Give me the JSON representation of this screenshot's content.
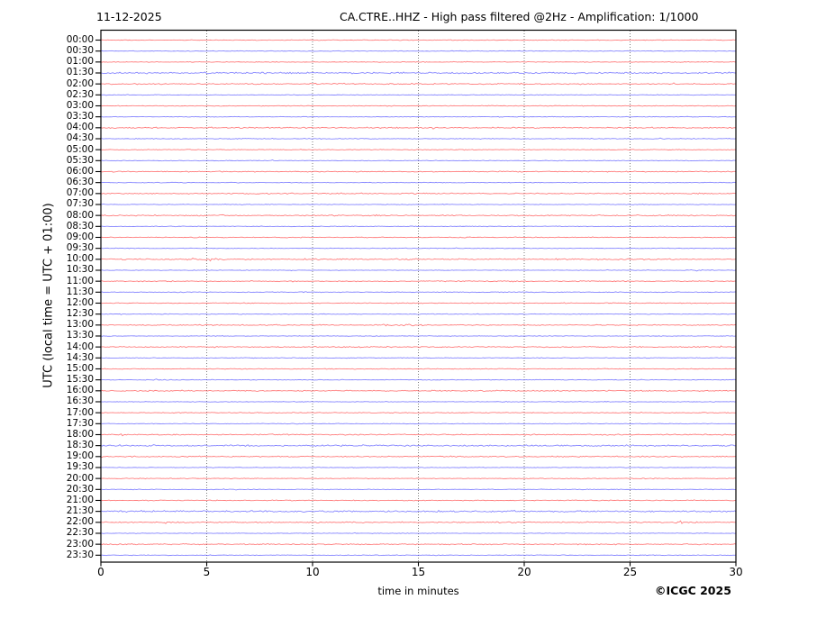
{
  "header": {
    "date_label": "11-12-2025",
    "title": "CA.CTRE..HHZ - High pass filtered @2Hz - Amplification: 1/1000"
  },
  "footer": {
    "copyright": "©ICGC 2025"
  },
  "chart_data": {
    "type": "line",
    "subtype": "helicorder-seismogram",
    "title": "CA.CTRE..HHZ - High pass filtered @2Hz - Amplification: 1/1000",
    "date": "11-12-2025",
    "xlabel": "time in minutes",
    "ylabel": "UTC (local time = UTC + 01:00)",
    "x_range": [
      0,
      30
    ],
    "x_ticks": [
      "0",
      "5",
      "10",
      "15",
      "20",
      "25",
      "30"
    ],
    "x_gridlines_minutes": [
      5,
      10,
      15,
      20,
      25
    ],
    "grid_style": "dotted-vertical",
    "minutes_per_row": 30,
    "row_count": 48,
    "colors": {
      "trace_red": "#ff2d2d",
      "trace_blue": "#3b3bff",
      "grid": "#6e6e6e",
      "frame": "#000000",
      "text": "#000000",
      "background": "#ffffff"
    },
    "rows": [
      {
        "label": "00:00",
        "color": "red",
        "noise": 0.55,
        "events": []
      },
      {
        "label": "00:30",
        "color": "blue",
        "noise": 0.5,
        "events": []
      },
      {
        "label": "01:00",
        "color": "red",
        "noise": 0.55,
        "events": []
      },
      {
        "label": "01:30",
        "color": "blue",
        "noise": 1.2,
        "events": []
      },
      {
        "label": "02:00",
        "color": "red",
        "noise": 0.9,
        "events": []
      },
      {
        "label": "02:30",
        "color": "blue",
        "noise": 0.5,
        "events": []
      },
      {
        "label": "03:00",
        "color": "red",
        "noise": 0.6,
        "events": []
      },
      {
        "label": "03:30",
        "color": "blue",
        "noise": 0.5,
        "events": []
      },
      {
        "label": "04:00",
        "color": "red",
        "noise": 0.9,
        "events": []
      },
      {
        "label": "04:30",
        "color": "blue",
        "noise": 0.6,
        "events": []
      },
      {
        "label": "05:00",
        "color": "red",
        "noise": 0.6,
        "events": []
      },
      {
        "label": "05:30",
        "color": "blue",
        "noise": 0.5,
        "events": []
      },
      {
        "label": "06:00",
        "color": "red",
        "noise": 0.7,
        "events": []
      },
      {
        "label": "06:30",
        "color": "blue",
        "noise": 0.5,
        "events": []
      },
      {
        "label": "07:00",
        "color": "red",
        "noise": 0.9,
        "events": []
      },
      {
        "label": "07:30",
        "color": "blue",
        "noise": 0.5,
        "events": []
      },
      {
        "label": "08:00",
        "color": "red",
        "noise": 0.9,
        "events": []
      },
      {
        "label": "08:30",
        "color": "blue",
        "noise": 0.5,
        "events": []
      },
      {
        "label": "09:00",
        "color": "red",
        "noise": 0.6,
        "events": []
      },
      {
        "label": "09:30",
        "color": "blue",
        "noise": 0.5,
        "events": []
      },
      {
        "label": "10:00",
        "color": "red",
        "noise": 1.0,
        "events": [
          {
            "minute": 5.0,
            "amp": 1.1,
            "width": 0.8
          }
        ]
      },
      {
        "label": "10:30",
        "color": "blue",
        "noise": 0.5,
        "events": [
          {
            "minute": 28.0,
            "amp": 0.8,
            "width": 0.5
          }
        ]
      },
      {
        "label": "11:00",
        "color": "red",
        "noise": 0.7,
        "events": [
          {
            "minute": 16.3,
            "amp": 0.9,
            "width": 0.3
          },
          {
            "minute": 19.5,
            "amp": 0.9,
            "width": 0.4
          }
        ]
      },
      {
        "label": "11:30",
        "color": "blue",
        "noise": 0.6,
        "events": [
          {
            "minute": 19.2,
            "amp": 0.7,
            "width": 0.4
          }
        ]
      },
      {
        "label": "12:00",
        "color": "red",
        "noise": 0.6,
        "events": []
      },
      {
        "label": "12:30",
        "color": "blue",
        "noise": 0.5,
        "events": []
      },
      {
        "label": "13:00",
        "color": "red",
        "noise": 0.8,
        "events": [
          {
            "minute": 13.8,
            "amp": 1.4,
            "width": 0.9
          }
        ]
      },
      {
        "label": "13:30",
        "color": "blue",
        "noise": 0.5,
        "events": []
      },
      {
        "label": "14:00",
        "color": "red",
        "noise": 0.9,
        "events": []
      },
      {
        "label": "14:30",
        "color": "blue",
        "noise": 0.5,
        "events": []
      },
      {
        "label": "15:00",
        "color": "red",
        "noise": 0.6,
        "events": []
      },
      {
        "label": "15:30",
        "color": "blue",
        "noise": 0.5,
        "events": [
          {
            "minute": 2.7,
            "amp": 0.9,
            "width": 0.3
          }
        ]
      },
      {
        "label": "16:00",
        "color": "red",
        "noise": 0.9,
        "events": []
      },
      {
        "label": "16:30",
        "color": "blue",
        "noise": 0.5,
        "events": []
      },
      {
        "label": "17:00",
        "color": "red",
        "noise": 0.6,
        "events": []
      },
      {
        "label": "17:30",
        "color": "blue",
        "noise": 0.5,
        "events": []
      },
      {
        "label": "18:00",
        "color": "red",
        "noise": 0.9,
        "events": []
      },
      {
        "label": "18:30",
        "color": "blue",
        "noise": 1.1,
        "events": []
      },
      {
        "label": "19:00",
        "color": "red",
        "noise": 0.9,
        "events": []
      },
      {
        "label": "19:30",
        "color": "blue",
        "noise": 0.5,
        "events": []
      },
      {
        "label": "20:00",
        "color": "red",
        "noise": 0.6,
        "events": []
      },
      {
        "label": "20:30",
        "color": "blue",
        "noise": 0.5,
        "events": []
      },
      {
        "label": "21:00",
        "color": "red",
        "noise": 0.6,
        "events": []
      },
      {
        "label": "21:30",
        "color": "blue",
        "noise": 1.2,
        "events": []
      },
      {
        "label": "22:00",
        "color": "red",
        "noise": 0.9,
        "events": [
          {
            "minute": 27.2,
            "amp": 1.0,
            "width": 0.6
          }
        ]
      },
      {
        "label": "22:30",
        "color": "blue",
        "noise": 0.5,
        "events": []
      },
      {
        "label": "23:00",
        "color": "red",
        "noise": 0.9,
        "events": []
      },
      {
        "label": "23:30",
        "color": "blue",
        "noise": 0.5,
        "events": []
      }
    ]
  }
}
